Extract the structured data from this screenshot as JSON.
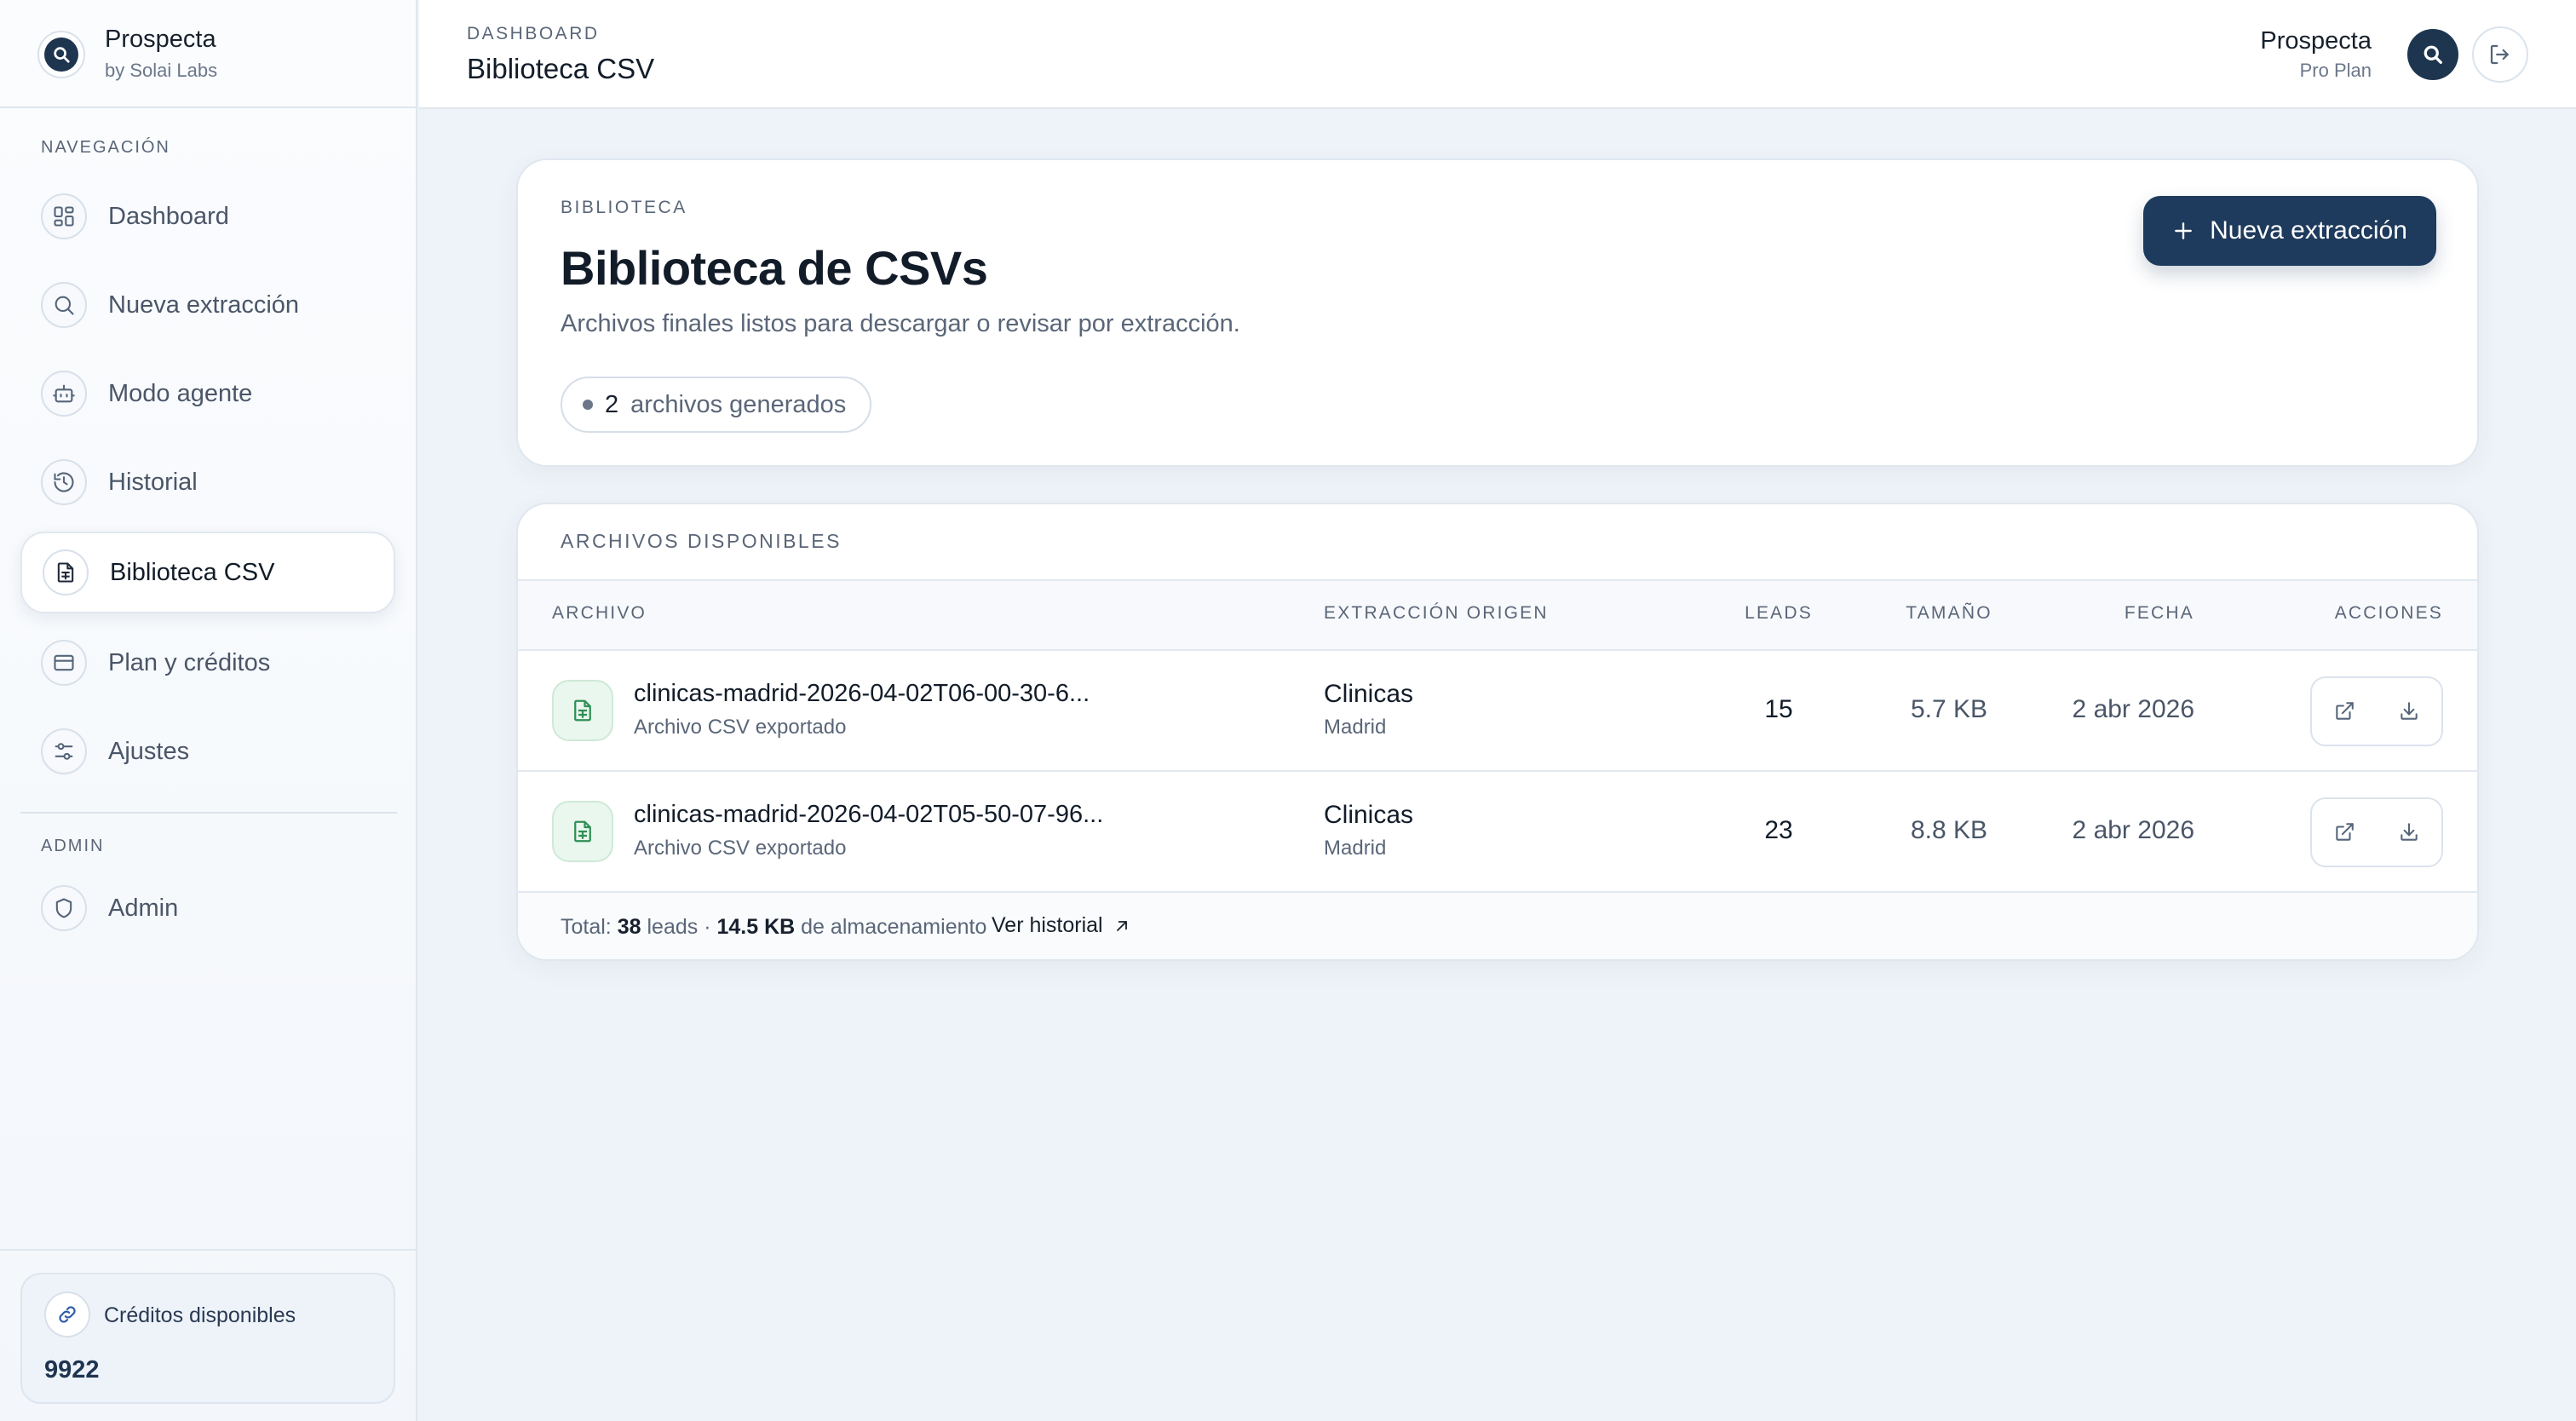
{
  "brand": {
    "name": "Prospecta",
    "sub": "by Solai Labs"
  },
  "sidebar": {
    "section_nav": "NAVEGACIÓN",
    "items": [
      {
        "label": "Dashboard",
        "icon": "grid-icon"
      },
      {
        "label": "Nueva extracción",
        "icon": "search-icon"
      },
      {
        "label": "Modo agente",
        "icon": "bot-icon"
      },
      {
        "label": "Historial",
        "icon": "history-icon"
      },
      {
        "label": "Biblioteca CSV",
        "icon": "file-spreadsheet-icon",
        "active": true
      },
      {
        "label": "Plan y créditos",
        "icon": "credit-card-icon"
      },
      {
        "label": "Ajustes",
        "icon": "sliders-icon"
      }
    ],
    "section_admin": "ADMIN",
    "admin_item": {
      "label": "Admin",
      "icon": "shield-icon"
    },
    "credits": {
      "title": "Créditos disponibles",
      "value": "9922",
      "icon": "link-icon"
    }
  },
  "topbar": {
    "crumb": "DASHBOARD",
    "title": "Biblioteca CSV",
    "user_name": "Prospecta",
    "user_plan": "Pro Plan"
  },
  "header": {
    "eyebrow": "BIBLIOTECA",
    "title": "Biblioteca de CSVs",
    "description": "Archivos finales listos para descargar o revisar por extracción.",
    "count": "2",
    "count_label": "archivos generados",
    "cta_label": "Nueva extracción"
  },
  "files": {
    "section_title": "ARCHIVOS DISPONIBLES",
    "columns": [
      "ARCHIVO",
      "EXTRACCIÓN ORIGEN",
      "LEADS",
      "TAMAÑO",
      "FECHA",
      "ACCIONES"
    ],
    "rows": [
      {
        "name": "clinicas-madrid-2026-04-02T06-00-30-6...",
        "sub": "Archivo CSV exportado",
        "origin": "Clinicas",
        "origin_sub": "Madrid",
        "leads": "15",
        "size": "5.7 KB",
        "date": "2 abr 2026"
      },
      {
        "name": "clinicas-madrid-2026-04-02T05-50-07-96...",
        "sub": "Archivo CSV exportado",
        "origin": "Clinicas",
        "origin_sub": "Madrid",
        "leads": "23",
        "size": "8.8 KB",
        "date": "2 abr 2026"
      }
    ],
    "footer": {
      "total_prefix": "Total:",
      "total_leads": "38",
      "leads_word": "leads ·",
      "total_size": "14.5 KB",
      "storage_word": "de almacenamiento",
      "history_link": "Ver historial"
    }
  },
  "colors": {
    "accent": "#1e3a5c",
    "csv_green": "#2f8f55"
  }
}
